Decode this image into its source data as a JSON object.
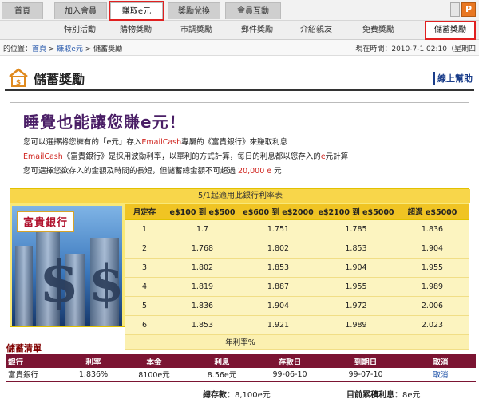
{
  "tabs": [
    {
      "label": "首頁"
    },
    {
      "label": "加入會員"
    },
    {
      "label": "賺取e元"
    },
    {
      "label": "獎勵兌換"
    },
    {
      "label": "會員互動"
    }
  ],
  "submenu": [
    {
      "label": "特別活動"
    },
    {
      "label": "購物獎勵"
    },
    {
      "label": "市調獎勵"
    },
    {
      "label": "郵件獎勵"
    },
    {
      "label": "介紹親友"
    },
    {
      "label": "免費獎勵"
    },
    {
      "label": "儲蓄獎勵"
    }
  ],
  "breadcrumb": {
    "prefix": "的位置：",
    "home": "首頁",
    "sep1": " > ",
    "earn": "賺取e元",
    "sep2": " > ",
    "current": "儲蓄獎勵",
    "time_label": "現在時間：",
    "time_value": "2010-7-1 02:10（星期四"
  },
  "page": {
    "title": "儲蓄獎勵",
    "help": "線上幫助"
  },
  "promo": {
    "headline": "睡覺也能讓您賺e元！",
    "line1_a": "您可以選擇將您擁有的「e元」存入",
    "line1_b": "EmailCash",
    "line1_c": "專屬的《富貴銀行》來賺取利息",
    "line2_a": "EmailCash",
    "line2_b": "《富貴銀行》是採用波動利率，以單利的方式計算，每日的利息都以您存入的",
    "line2_c": "e",
    "line2_d": "元計算",
    "line3_a": "您可選擇您欲存入的金額及時間的長短，但儲蓄總金額不可超過 ",
    "line3_b": "20,000 e",
    "line3_c": " 元"
  },
  "rate_table": {
    "caption": "5/1起適用此銀行利率表",
    "bank_name": "富貴銀行",
    "headers": [
      "月定存",
      "e$100 到 e$500",
      "e$600 到 e$2000",
      "e$2100 到 e$5000",
      "超過 e$5000"
    ],
    "rows": [
      [
        "1",
        "1.7",
        "1.751",
        "1.785",
        "1.836"
      ],
      [
        "2",
        "1.768",
        "1.802",
        "1.853",
        "1.904"
      ],
      [
        "3",
        "1.802",
        "1.853",
        "1.904",
        "1.955"
      ],
      [
        "4",
        "1.819",
        "1.887",
        "1.955",
        "1.989"
      ],
      [
        "5",
        "1.836",
        "1.904",
        "1.972",
        "2.006"
      ],
      [
        "6",
        "1.853",
        "1.921",
        "1.989",
        "2.023"
      ]
    ],
    "footer": "年利率%"
  },
  "savings": {
    "title": "儲蓄清單",
    "headers": [
      "銀行",
      "利率",
      "本金",
      "利息",
      "存款日",
      "到期日",
      "取消"
    ],
    "rows": [
      [
        "富貴銀行",
        "1.836%",
        "8100e元",
        "8.56e元",
        "99-06-10",
        "99-07-10",
        "取消"
      ]
    ],
    "total_deposit_label": "總存款：",
    "total_deposit_value": "8,100e元",
    "total_interest_label": "目前累積利息：",
    "total_interest_value": "8e元"
  },
  "colors": {
    "highlight": "#e02020",
    "promo_purple": "#4a1e66",
    "savings_header": "#7b1432",
    "rate_bg": "#f8e878"
  }
}
